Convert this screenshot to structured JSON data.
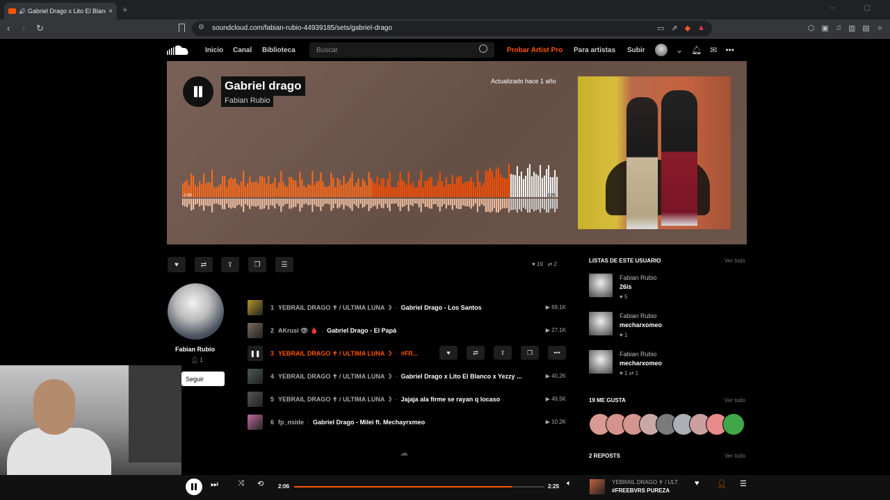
{
  "browser": {
    "tab_title": "Gabriel Drago x Lito El Blanco",
    "tab_close": "×",
    "new_tab": "+",
    "url": "soundcloud.com/fabian-rubio-44939185/sets/gabriel-drago"
  },
  "header": {
    "nav": [
      "Inicio",
      "Canal",
      "Biblioteca"
    ],
    "search_placeholder": "Buscar",
    "pro_label": "Probar Artist Pro",
    "artists_label": "Para artistas",
    "upload_label": "Subir"
  },
  "hero": {
    "title": "Gabriel drago",
    "artist": "Fabian Rubio",
    "updated": "Actualizado hace 1 año",
    "wave_time_left": "2:06",
    "wave_time_right": "2:25",
    "progress": 0.87,
    "accent": "#ff5500"
  },
  "stats": {
    "likes": "19",
    "reposts": "2"
  },
  "user": {
    "name": "Fabian Rubio",
    "followers": "1",
    "follow_label": "Seguir"
  },
  "tracks": [
    {
      "num": "1",
      "artist": "YEBRAIL DRAGO ✝ / ULTIMA LUNA ☽",
      "title": "Gabriel Drago - Los Santos",
      "plays": "69,1K",
      "color": "#b5952a"
    },
    {
      "num": "2",
      "artist": "AKrusi 👁 🩸",
      "title": "Gabriel Drago - El Papá",
      "plays": "27,1K",
      "color": "#7b6a5c"
    },
    {
      "num": "3",
      "artist": "YEBRAIL DRAGO ✝ / ULTIMA LUNA ☽",
      "title": "#FR...",
      "plays": "",
      "color": "#333"
    },
    {
      "num": "4",
      "artist": "YEBRAIL DRAGO ✝ / ULTIMA LUNA ☽",
      "title": "Gabriel Drago x Lito El Blanco x Yezzy ...",
      "plays": "40,2K",
      "color": "#4a5a52"
    },
    {
      "num": "5",
      "artist": "YEBRAIL DRAGO ✝ / ULTIMA LUNA ☽",
      "title": "Jajaja ala firme se rayan q locaso",
      "plays": "49,5K",
      "color": "#555"
    },
    {
      "num": "6",
      "artist": "fp_nside",
      "title": "Gabriel Drago - Milei ft. Mechayrxmeo",
      "plays": "10,2K",
      "color": "#c06aa0"
    }
  ],
  "sidebar": {
    "playlists_title": "LISTAS DE ESTE USUARIO",
    "see_all": "Ver todo",
    "playlists": [
      {
        "user": "Fabian Rubio",
        "name": "26is",
        "likes": "♥ 5"
      },
      {
        "user": "Fabian Rubio",
        "name": "mecharxomeo",
        "likes": "♥ 1"
      },
      {
        "user": "Fabian Rubio",
        "name": "mecharxomeo",
        "likes": "♥ 1  ⇄ 1"
      }
    ],
    "likes_title": "19 ME GUSTA",
    "reposts_title": "2 REPOSTS"
  },
  "player": {
    "current": "2:06",
    "duration": "2:25",
    "progress": 0.87,
    "artist": "YEBRAIL DRAGO ✝ / ULT",
    "title": "#FREEBVRS PUREZA"
  }
}
